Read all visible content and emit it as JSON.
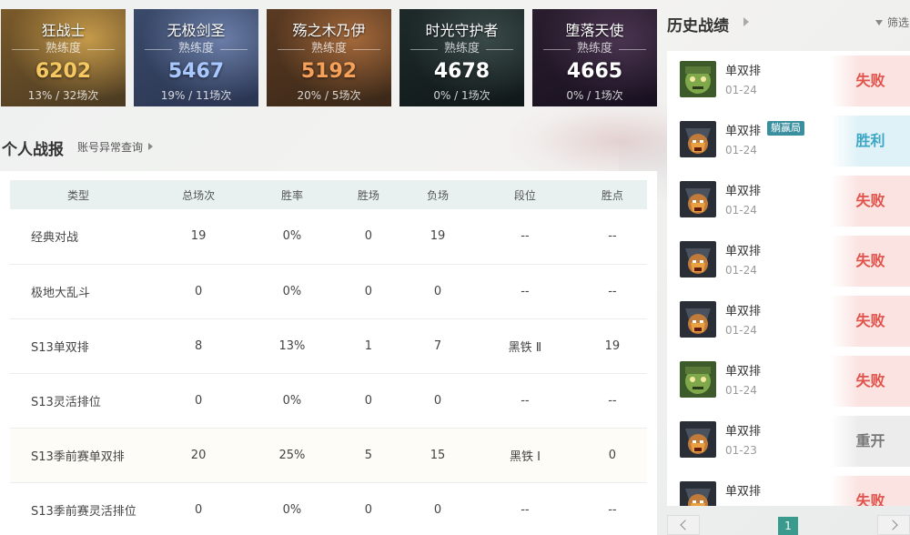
{
  "champions": [
    {
      "name": "狂战士",
      "mastery_label": "熟练度",
      "score": "6202",
      "sub": "13% / 32场次",
      "score_color": "#f6c862",
      "bg": [
        "#7a5a2a",
        "#c59a4a",
        "#4a3a22"
      ]
    },
    {
      "name": "无极剑圣",
      "mastery_label": "熟练度",
      "score": "5467",
      "sub": "19% / 11场次",
      "score_color": "#a9c8ff",
      "bg": [
        "#3a4a6a",
        "#6b7ea8",
        "#2a3552"
      ]
    },
    {
      "name": "殇之木乃伊",
      "mastery_label": "熟练度",
      "score": "5192",
      "sub": "20% / 5场次",
      "score_color": "#f6a15a",
      "bg": [
        "#5a3a22",
        "#a3683a",
        "#3a2818"
      ]
    },
    {
      "name": "时光守护者",
      "mastery_label": "熟练度",
      "score": "4678",
      "sub": "0% / 1场次",
      "score_color": "#ffffff",
      "bg": [
        "#1e2a2a",
        "#3a4a48",
        "#101818"
      ]
    },
    {
      "name": "堕落天使",
      "mastery_label": "熟练度",
      "score": "4665",
      "sub": "0% / 1场次",
      "score_color": "#ffffff",
      "bg": [
        "#2a1e2e",
        "#4a3450",
        "#181020"
      ]
    }
  ],
  "personal": {
    "title": "个人战报",
    "account_link": "账号异常查询"
  },
  "table": {
    "headers": [
      "类型",
      "总场次",
      "胜率",
      "胜场",
      "负场",
      "段位",
      "胜点"
    ],
    "rows": [
      [
        "经典对战",
        "19",
        "0%",
        "0",
        "19",
        "--",
        "--"
      ],
      [
        "极地大乱斗",
        "0",
        "0%",
        "0",
        "0",
        "--",
        "--"
      ],
      [
        "S13单双排",
        "8",
        "13%",
        "1",
        "7",
        "黑铁 Ⅱ",
        "19"
      ],
      [
        "S13灵活排位",
        "0",
        "0%",
        "0",
        "0",
        "--",
        "--"
      ],
      [
        "S13季前赛单双排",
        "20",
        "25%",
        "5",
        "15",
        "黑铁 Ⅰ",
        "0"
      ],
      [
        "S13季前赛灵活排位",
        "0",
        "0%",
        "0",
        "0",
        "--",
        "--"
      ]
    ]
  },
  "history": {
    "title": "历史战绩",
    "filter_label": "筛选",
    "matches": [
      {
        "mode": "单双排",
        "date": "01-24",
        "tag": "",
        "result": "失败",
        "kind": "lose",
        "champ": "green"
      },
      {
        "mode": "单双排",
        "date": "01-24",
        "tag": "躺赢局",
        "result": "胜利",
        "kind": "win",
        "champ": "dark"
      },
      {
        "mode": "单双排",
        "date": "01-24",
        "tag": "",
        "result": "失败",
        "kind": "lose",
        "champ": "dark"
      },
      {
        "mode": "单双排",
        "date": "01-24",
        "tag": "",
        "result": "失败",
        "kind": "lose",
        "champ": "dark"
      },
      {
        "mode": "单双排",
        "date": "01-24",
        "tag": "",
        "result": "失败",
        "kind": "lose",
        "champ": "dark"
      },
      {
        "mode": "单双排",
        "date": "01-24",
        "tag": "",
        "result": "失败",
        "kind": "lose",
        "champ": "green"
      },
      {
        "mode": "单双排",
        "date": "01-23",
        "tag": "",
        "result": "重开",
        "kind": "remake",
        "champ": "dark"
      },
      {
        "mode": "单双排",
        "date": "",
        "tag": "",
        "result": "失败",
        "kind": "lose",
        "champ": "dark"
      }
    ]
  },
  "pager": {
    "current_page": "1"
  },
  "colors": {
    "accent": "#3a9a8d",
    "lose": "#e0524a",
    "win": "#3ba7c4",
    "remake": "#777777",
    "tag": "#3a8f9e"
  }
}
